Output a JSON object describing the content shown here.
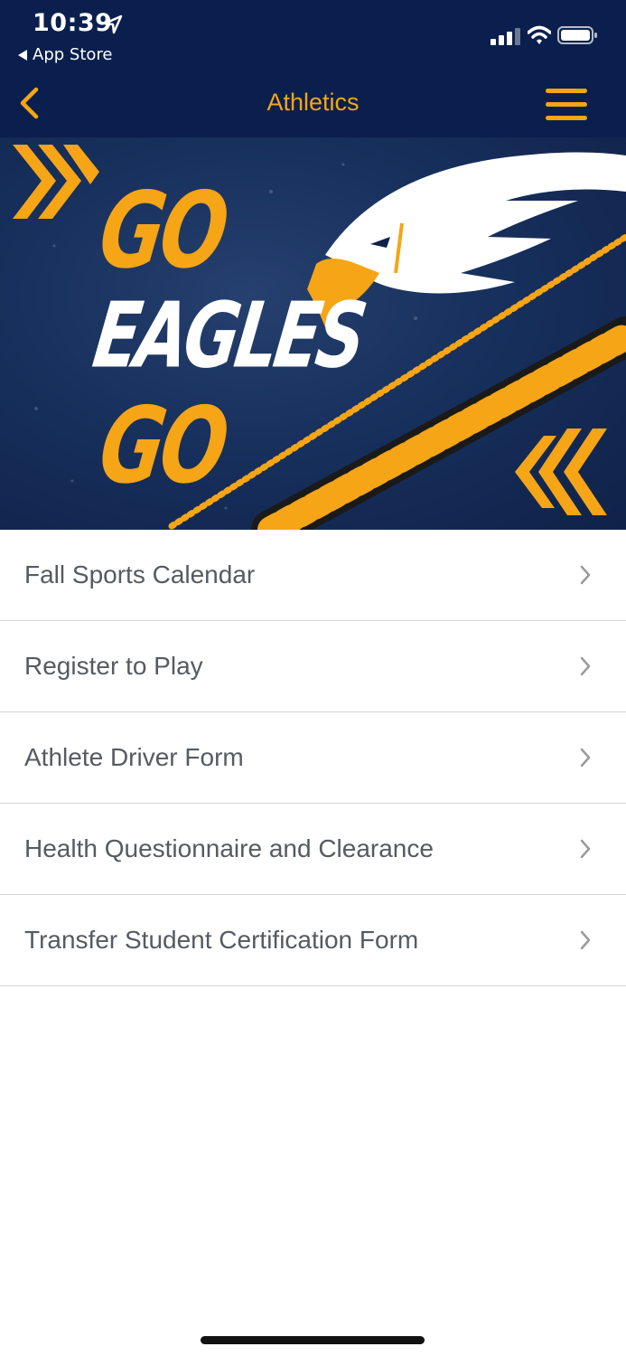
{
  "status_bar": {
    "time": "10:39",
    "back_app": "App Store",
    "icons": [
      "location-arrow-icon",
      "cellular-signal-icon",
      "wifi-icon",
      "battery-icon"
    ]
  },
  "nav": {
    "title": "Athletics",
    "back_icon": "chevron-left-icon",
    "menu_icon": "hamburger-menu-icon",
    "accent_color": "#f5a515",
    "background_color": "#0a1f4d"
  },
  "banner": {
    "line1": "GO",
    "line2": "EAGLES",
    "line3": "GO",
    "gold": "#f5a515",
    "navy": "#17305d"
  },
  "list": {
    "items": [
      {
        "label": "Fall Sports Calendar"
      },
      {
        "label": "Register to Play"
      },
      {
        "label": "Athlete Driver Form"
      },
      {
        "label": "Health Questionnaire and Clearance"
      },
      {
        "label": "Transfer Student Certification Form"
      }
    ],
    "text_color": "#555b61",
    "chevron_icon": "chevron-right-icon"
  }
}
